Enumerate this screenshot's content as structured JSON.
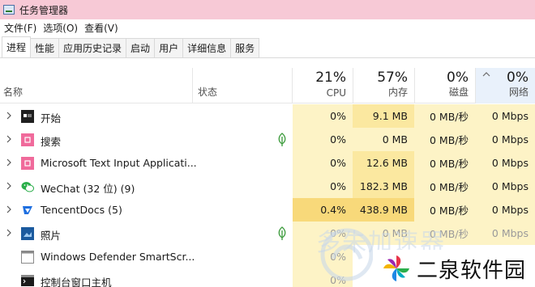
{
  "window": {
    "title": "任务管理器"
  },
  "menu": [
    "文件(F)",
    "选项(O)",
    "查看(V)"
  ],
  "tabs": [
    "进程",
    "性能",
    "应用历史记录",
    "启动",
    "用户",
    "详细信息",
    "服务"
  ],
  "header": {
    "name": "名称",
    "status": "状态",
    "cpu": {
      "pct": "21%",
      "label": "CPU"
    },
    "memory": {
      "pct": "57%",
      "label": "内存"
    },
    "disk": {
      "pct": "0%",
      "label": "磁盘"
    },
    "network": {
      "pct": "0%",
      "label": "网络"
    }
  },
  "processes": [
    {
      "name": "开始",
      "icon": "start-icon",
      "cpu": "0%",
      "mem": "9.1 MB",
      "disk": "0 MB/秒",
      "net": "0 Mbps"
    },
    {
      "name": "搜索",
      "icon": "search-app-icon",
      "cpu": "0%",
      "mem": "0 MB",
      "disk": "0 MB/秒",
      "net": "0 Mbps"
    },
    {
      "name": "Microsoft Text Input Applicati...",
      "icon": "text-input-icon",
      "cpu": "0%",
      "mem": "12.6 MB",
      "disk": "0 MB/秒",
      "net": "0 Mbps"
    },
    {
      "name": "WeChat (32 位) (9)",
      "icon": "wechat-icon",
      "cpu": "0%",
      "mem": "182.3 MB",
      "disk": "0 MB/秒",
      "net": "0 Mbps"
    },
    {
      "name": "TencentDocs (5)",
      "icon": "tencentdocs-icon",
      "cpu": "0.4%",
      "mem": "438.9 MB",
      "disk": "0 MB/秒",
      "net": "0 Mbps"
    },
    {
      "name": "照片",
      "icon": "photos-icon",
      "cpu": "0%",
      "mem": "0 MB",
      "disk": "0 MB/秒",
      "net": "0 Mbps"
    },
    {
      "name": "Windows Defender SmartScr...",
      "icon": "defender-icon",
      "cpu": "0%",
      "mem": "",
      "disk": "",
      "net": ""
    },
    {
      "name": "控制台窗口主机",
      "icon": "console-icon",
      "cpu": "0%",
      "mem": "",
      "disk": "",
      "net": ""
    }
  ],
  "watermark": {
    "text": "二泉软件园",
    "ghost": "多朱加速器"
  },
  "colors": {
    "titlebar": "#f7c9d6",
    "heat_low": "#fdf3c6",
    "heat_mid": "#fbe8a0",
    "heat_high": "#f8d97a"
  }
}
